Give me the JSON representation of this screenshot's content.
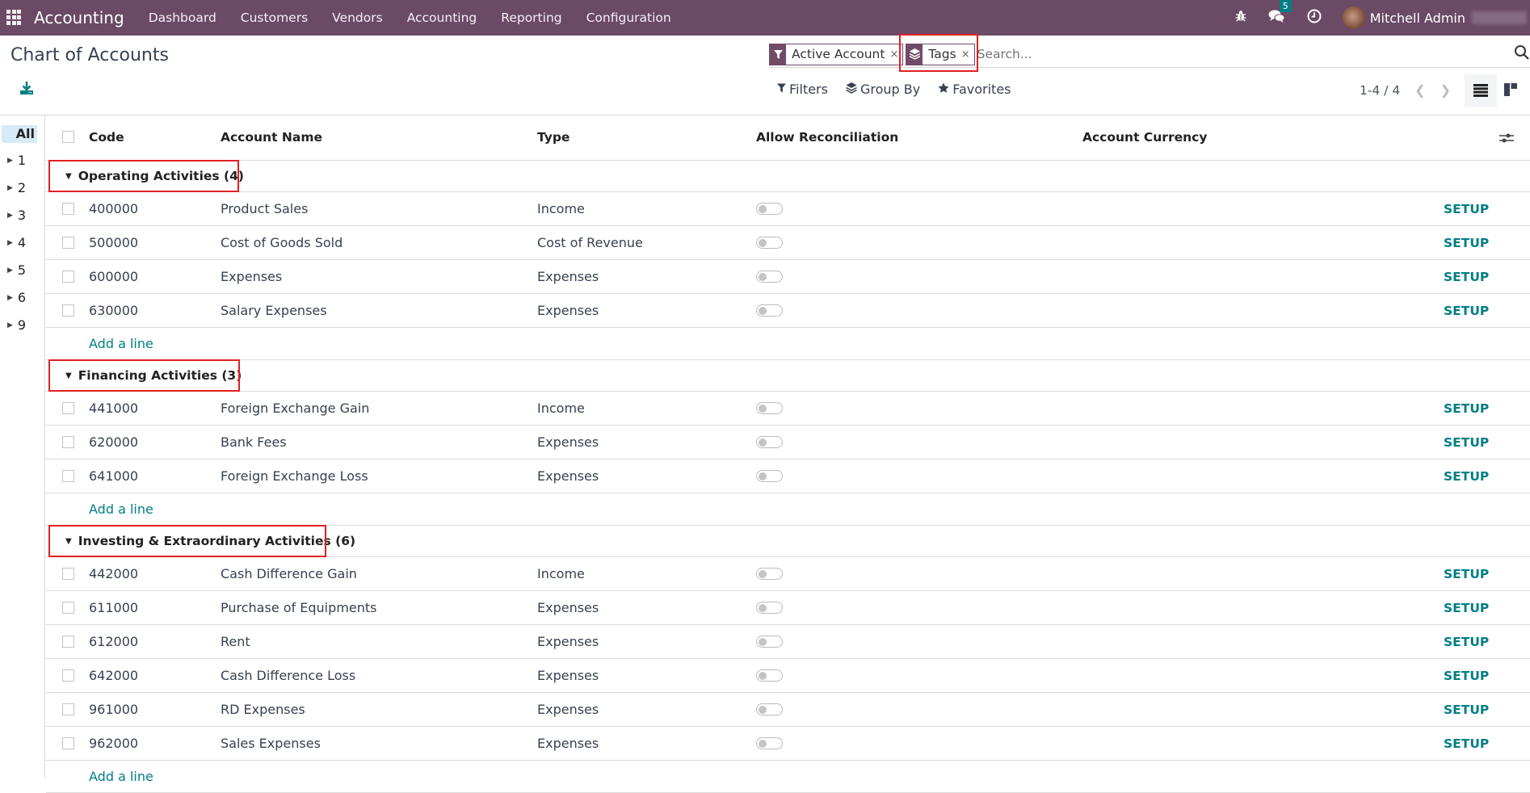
{
  "navbar": {
    "app_name": "Accounting",
    "menu": [
      "Dashboard",
      "Customers",
      "Vendors",
      "Accounting",
      "Reporting",
      "Configuration"
    ],
    "messages_badge": "5",
    "user_name": "Mitchell Admin"
  },
  "page": {
    "title": "Chart of Accounts"
  },
  "search": {
    "facets": [
      {
        "icon": "filter-icon",
        "label": "Active Account",
        "remove": "×"
      },
      {
        "icon": "layers-icon",
        "label": "Tags",
        "remove": "×"
      }
    ],
    "placeholder": "Search..."
  },
  "toolbar": {
    "filters_label": "Filters",
    "groupby_label": "Group By",
    "favorites_label": "Favorites",
    "pager": "1-4 / 4"
  },
  "side_panel": {
    "all_label": "All",
    "items": [
      "1",
      "2",
      "3",
      "4",
      "5",
      "6",
      "9"
    ]
  },
  "table": {
    "columns": [
      "Code",
      "Account Name",
      "Type",
      "Allow Reconciliation",
      "Account Currency"
    ],
    "add_line_label": "Add a line",
    "setup_label": "SETUP",
    "groups": [
      {
        "label": "Operating Activities (4)",
        "rows": [
          {
            "code": "400000",
            "name": "Product Sales",
            "type": "Income",
            "reconcile": false
          },
          {
            "code": "500000",
            "name": "Cost of Goods Sold",
            "type": "Cost of Revenue",
            "reconcile": false
          },
          {
            "code": "600000",
            "name": "Expenses",
            "type": "Expenses",
            "reconcile": false
          },
          {
            "code": "630000",
            "name": "Salary Expenses",
            "type": "Expenses",
            "reconcile": false
          }
        ]
      },
      {
        "label": "Financing Activities (3)",
        "rows": [
          {
            "code": "441000",
            "name": "Foreign Exchange Gain",
            "type": "Income",
            "reconcile": false
          },
          {
            "code": "620000",
            "name": "Bank Fees",
            "type": "Expenses",
            "reconcile": false
          },
          {
            "code": "641000",
            "name": "Foreign Exchange Loss",
            "type": "Expenses",
            "reconcile": false
          }
        ]
      },
      {
        "label": "Investing & Extraordinary Activities (6)",
        "rows": [
          {
            "code": "442000",
            "name": "Cash Difference Gain",
            "type": "Income",
            "reconcile": false
          },
          {
            "code": "611000",
            "name": "Purchase of Equipments",
            "type": "Expenses",
            "reconcile": false
          },
          {
            "code": "612000",
            "name": "Rent",
            "type": "Expenses",
            "reconcile": false
          },
          {
            "code": "642000",
            "name": "Cash Difference Loss",
            "type": "Expenses",
            "reconcile": false
          },
          {
            "code": "961000",
            "name": "RD Expenses",
            "type": "Expenses",
            "reconcile": false
          },
          {
            "code": "962000",
            "name": "Sales Expenses",
            "type": "Expenses",
            "reconcile": false
          }
        ]
      }
    ]
  },
  "colors": {
    "navbar": "#6b4a66",
    "brand": "#714b67",
    "link": "#017e84",
    "highlight": "#e02020"
  }
}
